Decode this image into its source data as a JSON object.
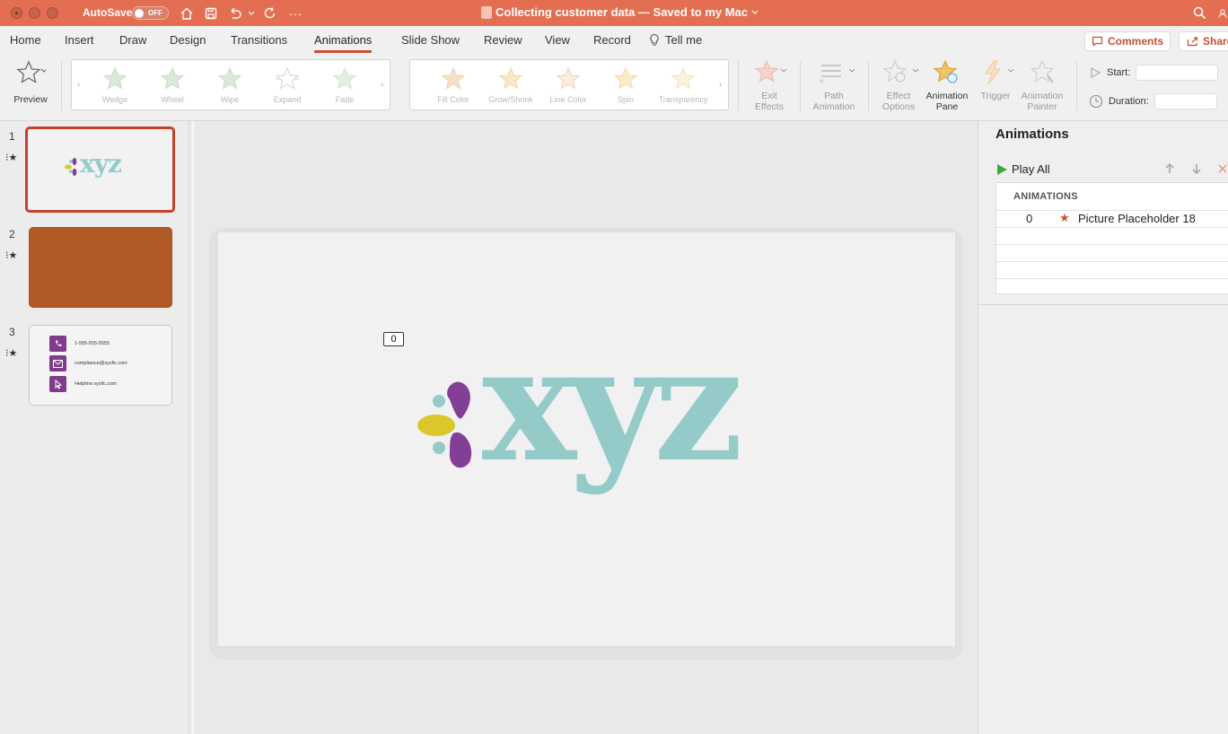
{
  "titlebar": {
    "autosave_label": "AutoSave",
    "autosave_state": "OFF",
    "document_title": "Collecting customer data — Saved to my Mac",
    "icons": [
      "home-icon",
      "save-icon",
      "undo-icon",
      "redo-icon",
      "more-icon",
      "search-icon",
      "account-icon"
    ]
  },
  "menu": {
    "tabs": [
      "Home",
      "Insert",
      "Draw",
      "Design",
      "Transitions",
      "Animations",
      "Slide Show",
      "Review",
      "View",
      "Record"
    ],
    "active_tab": "Animations",
    "tell_me": "Tell me",
    "comments": "Comments",
    "share": "Share"
  },
  "ribbon": {
    "preview": "Preview",
    "entrance_effects": [
      "Wedge",
      "Wheel",
      "Wipe",
      "Expand",
      "Fade"
    ],
    "emphasis_effects": [
      "Fill Color",
      "Grow/Shrink",
      "Line Color",
      "Spin",
      "Transparency"
    ],
    "exit_effects_line1": "Exit",
    "exit_effects_line2": "Effects",
    "path_animation_line1": "Path",
    "path_animation_line2": "Animation",
    "effect_options_line1": "Effect",
    "effect_options_line2": "Options",
    "animation_pane_line1": "Animation",
    "animation_pane_line2": "Pane",
    "trigger": "Trigger",
    "animation_painter_line1": "Animation",
    "animation_painter_line2": "Painter",
    "start_label": "Start:",
    "duration_label": "Duration:"
  },
  "slides": {
    "items": [
      {
        "number": "1",
        "thumb_logo": "xyz"
      },
      {
        "number": "2"
      },
      {
        "number": "3"
      }
    ],
    "slide3": {
      "phone": "1-555-555-5555",
      "email": "compliance@xyzllc.com",
      "web": "Helpline.xyzllc.com"
    }
  },
  "canvas": {
    "animation_tag": "0",
    "logo_text": "xyz",
    "colors": {
      "logo_teal": "#94cbc9",
      "petal_purple": "#833e95",
      "petal_yellow": "#dcc72b",
      "dot_teal": "#94cbc9",
      "slide2_bg": "#b05a26"
    }
  },
  "animation_pane": {
    "title": "Animations",
    "play_all": "Play All",
    "header": "ANIMATIONS",
    "items": [
      {
        "order": "0",
        "name": "Picture Placeholder 18"
      }
    ]
  },
  "colors": {
    "titlebar": "#e46e52",
    "accent": "#c4412a"
  }
}
